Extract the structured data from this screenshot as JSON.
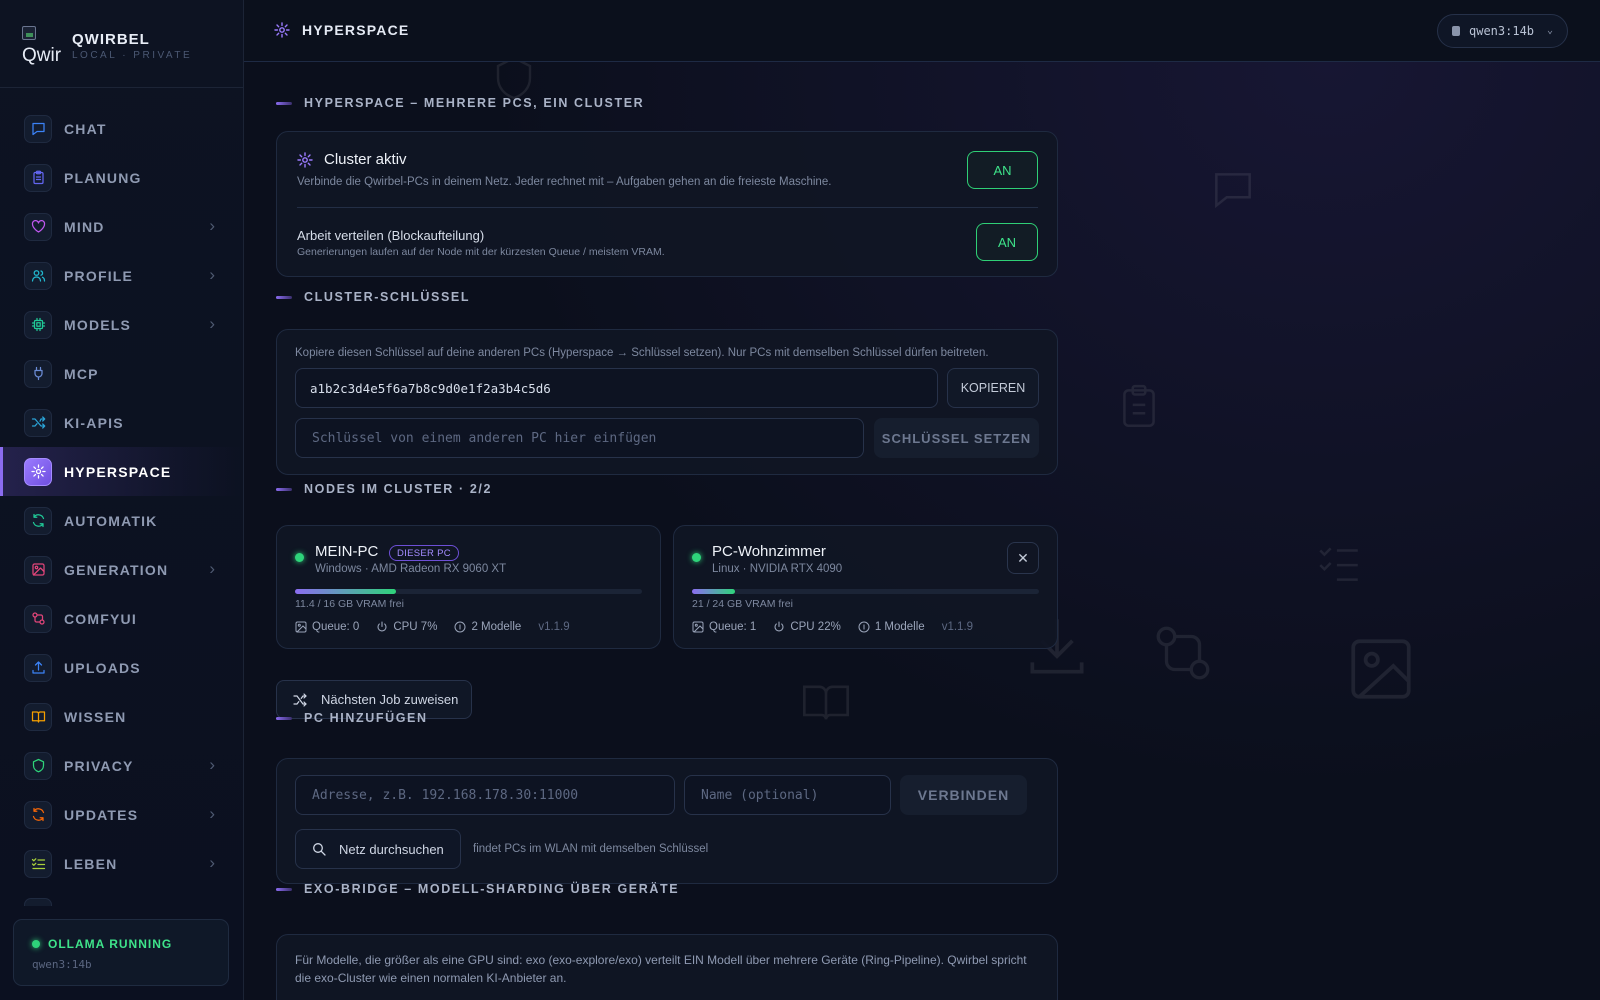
{
  "brand": {
    "logo_text": "Qwir",
    "name": "QWIRBEL",
    "subtitle": "LOCAL · PRIVATE"
  },
  "colors": {
    "accent": "#8b6cf0",
    "success": "#2ed47a",
    "background": "#0a0e18"
  },
  "sidebar": {
    "items": [
      {
        "label": "CHAT",
        "icon": "chat-icon",
        "color": "#3b82f6",
        "chevron": false
      },
      {
        "label": "PLANUNG",
        "icon": "clipboard-icon",
        "color": "#6366f1",
        "chevron": false
      },
      {
        "label": "MIND",
        "icon": "heart-icon",
        "color": "#c058f0",
        "chevron": true
      },
      {
        "label": "PROFILE",
        "icon": "users-icon",
        "color": "#22b8cf",
        "chevron": true
      },
      {
        "label": "MODELS",
        "icon": "cpu-icon",
        "color": "#20c997",
        "chevron": true
      },
      {
        "label": "MCP",
        "icon": "plug-icon",
        "color": "#6b8cd6",
        "chevron": false
      },
      {
        "label": "KI-APIS",
        "icon": "shuffle-icon",
        "color": "#2ba3d6",
        "chevron": false
      },
      {
        "label": "HYPERSPACE",
        "icon": "sparkle-icon",
        "color": "#ffffff",
        "chevron": false
      },
      {
        "label": "AUTOMATIK",
        "icon": "refresh-icon",
        "color": "#20c997",
        "chevron": false
      },
      {
        "label": "GENERATION",
        "icon": "image-icon",
        "color": "#e2457a",
        "chevron": true
      },
      {
        "label": "COMFYUI",
        "icon": "workflow-icon",
        "color": "#e2457a",
        "chevron": false
      },
      {
        "label": "UPLOADS",
        "icon": "upload-icon",
        "color": "#3b82f6",
        "chevron": false
      },
      {
        "label": "WISSEN",
        "icon": "book-icon",
        "color": "#f59f00",
        "chevron": false
      },
      {
        "label": "PRIVACY",
        "icon": "shield-icon",
        "color": "#2ed47a",
        "chevron": true
      },
      {
        "label": "UPDATES",
        "icon": "refresh-icon",
        "color": "#f76707",
        "chevron": true
      },
      {
        "label": "LEBEN",
        "icon": "checklist-icon",
        "color": "#a9d13a",
        "chevron": true
      }
    ],
    "active_index": 7
  },
  "status": {
    "label": "OLLAMA RUNNING",
    "model": "qwen3:14b"
  },
  "topbar": {
    "title": "HYPERSPACE",
    "model": "qwen3:14b"
  },
  "cluster": {
    "section_title": "HYPERSPACE – MEHRERE PCS, EIN CLUSTER",
    "active_title": "Cluster aktiv",
    "active_desc": "Verbinde die Qwirbel-PCs in deinem Netz. Jeder rechnet mit – Aufgaben gehen an die freieste Maschine.",
    "active_toggle": "AN",
    "distribute_title": "Arbeit verteilen (Blockaufteilung)",
    "distribute_desc": "Generierungen laufen auf der Node mit der kürzesten Queue / meistem VRAM.",
    "distribute_toggle": "AN"
  },
  "key": {
    "section_title": "CLUSTER-SCHLÜSSEL",
    "hint": "Kopiere diesen Schlüssel auf deine anderen PCs (Hyperspace → Schlüssel setzen). Nur PCs mit demselben Schlüssel dürfen beitreten.",
    "value": "a1b2c3d4e5f6a7b8c9d0e1f2a3b4c5d6",
    "copy_label": "KOPIEREN",
    "paste_placeholder": "Schlüssel von einem anderen PC hier einfügen",
    "set_label": "SCHLÜSSEL SETZEN"
  },
  "nodes": {
    "section_title": "NODES IM CLUSTER · 2/2",
    "list": [
      {
        "name": "MEIN-PC",
        "badge": "DIESER PC",
        "os": "Windows · AMD Radeon RX 9060 XT",
        "vram_text": "11.4 / 16 GB VRAM frei",
        "vram_free_fraction": 0.29,
        "queue": "Queue: 0",
        "cpu": "CPU 7%",
        "models": "2 Modelle",
        "version": "v1.1.9"
      },
      {
        "name": "PC-Wohnzimmer",
        "os": "Linux · NVIDIA RTX 4090",
        "vram_text": "21 / 24 GB VRAM frei",
        "vram_free_fraction": 0.125,
        "queue": "Queue: 1",
        "cpu": "CPU 22%",
        "models": "1 Modelle",
        "version": "v1.1.9",
        "close": "✕"
      }
    ],
    "assign_label": "Nächsten Job zuweisen"
  },
  "add_pc": {
    "section_title": "PC HINZUFÜGEN",
    "address_placeholder": "Adresse, z.B. 192.168.178.30:11000",
    "name_placeholder": "Name (optional)",
    "connect_label": "VERBINDEN",
    "scan_label": "Netz durchsuchen",
    "scan_hint": "findet PCs im WLAN mit demselben Schlüssel"
  },
  "exo": {
    "section_title": "EXO-BRIDGE – MODELL-SHARDING ÜBER GERÄTE",
    "desc": "Für Modelle, die größer als eine GPU sind: exo (exo-explore/exo) verteilt EIN Modell über mehrere Geräte (Ring-Pipeline). Qwirbel spricht die exo-Cluster wie einen normalen KI-Anbieter an."
  }
}
